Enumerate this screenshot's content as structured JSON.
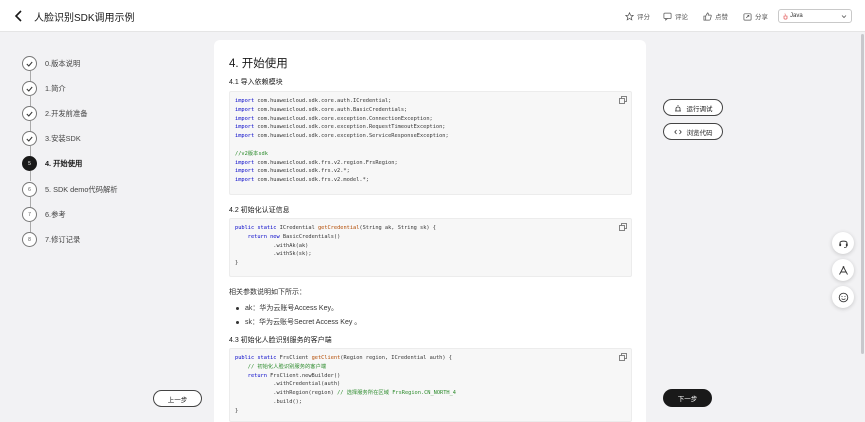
{
  "header": {
    "title": "人脸识别SDK调用示例",
    "actions": {
      "rate": "评分",
      "comment": "评论",
      "like": "点赞",
      "share": "分享"
    },
    "language": {
      "selected": "Java"
    }
  },
  "sidebar": {
    "steps": [
      {
        "num": "0",
        "label": "0.版本说明",
        "state": "done"
      },
      {
        "num": "1",
        "label": "1.简介",
        "state": "done"
      },
      {
        "num": "2",
        "label": "2.开发前准备",
        "state": "done"
      },
      {
        "num": "3",
        "label": "3.安装SDK",
        "state": "done"
      },
      {
        "num": "5",
        "label": "4. 开始使用",
        "state": "active"
      },
      {
        "num": "6",
        "label": "5. SDK demo代码解析",
        "state": "pending"
      },
      {
        "num": "7",
        "label": "6.参考",
        "state": "pending"
      },
      {
        "num": "8",
        "label": "7.修订记录",
        "state": "pending"
      }
    ],
    "prev_label": "上一步"
  },
  "content": {
    "heading": "4. 开始使用",
    "s1_title": "4.1 导入依赖模块",
    "s2_title": "4.2 初始化认证信息",
    "params_intro": "相关参数说明如下所示：",
    "bullets": [
      "ak：华为云账号Access Key。",
      "sk：华为云账号Secret Access Key 。"
    ],
    "s3_title": "4.3 初始化人脸识别服务的客户端"
  },
  "right": {
    "run_debug": "运行调试",
    "browse_code": "浏览代码",
    "next_label": "下一步"
  },
  "colors": {
    "keyword": "#0000c8",
    "function": "#b24a00",
    "comment": "#2a8a2a",
    "primary_button": "#191919"
  },
  "icons": {
    "float": [
      "headset-icon",
      "pencil-ruler-icon",
      "smiley-icon"
    ]
  }
}
